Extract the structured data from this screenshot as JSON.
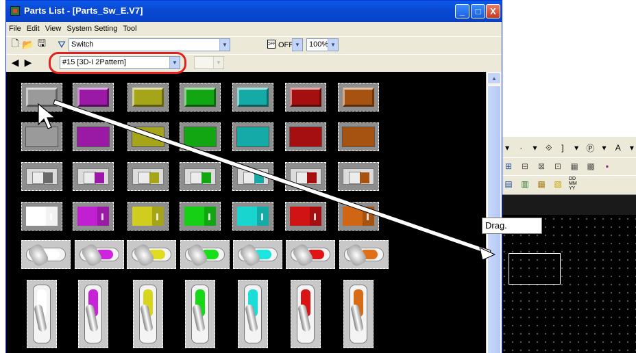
{
  "window": {
    "title": "Parts List - [Parts_Sw_E.V7]",
    "controls": {
      "minimize": "_",
      "maximize": "□",
      "close": "X"
    }
  },
  "menubar": [
    {
      "label": "File"
    },
    {
      "label": "Edit"
    },
    {
      "label": "View"
    },
    {
      "label": "System Setting"
    },
    {
      "label": "Tool"
    }
  ],
  "toolbar1": {
    "icons": [
      "new-file-icon",
      "open-folder-icon",
      "save-icon"
    ],
    "category_combo": "Switch",
    "state_badge": "OFF",
    "state_combo": "OFF",
    "zoom_combo": "100%"
  },
  "toolbar2": {
    "icons": [
      "back-arrow-icon",
      "forward-arrow-icon"
    ],
    "pattern_combo": "#15 [3D-I 2Pattern]",
    "disabled_combo": ""
  },
  "colors": {
    "gray": "#9a9a9a",
    "purple": "#9a1aa6",
    "olive": "#a6a418",
    "green": "#12a612",
    "cyan": "#14aaa6",
    "red": "#a60f0f",
    "orange": "#a65210",
    "highlight": "#e61e1e",
    "canvas": "#000000"
  },
  "parts_grid": {
    "row_styles": [
      "3d-button",
      "flat-button",
      "slide-switch",
      "rocker-switch",
      "lever-pill",
      "toggle-switch"
    ],
    "column_colors": [
      "gray",
      "purple",
      "olive",
      "green",
      "cyan",
      "red",
      "orange"
    ]
  },
  "annotation": {
    "drag_label": "Drag."
  },
  "editor": {
    "toolbar_glyphs_row1": [
      "▾",
      "·",
      "▾",
      "⟐",
      "]",
      "▾",
      "Ⓟ",
      "▾",
      "A",
      "▾"
    ],
    "toolbar_glyphs_row2": [
      "⊞",
      "⊟",
      "⊠",
      "⊡",
      "▦",
      "▩",
      "▪"
    ],
    "toolbar_glyphs_row3": [
      "▤",
      "▥",
      "▦",
      "▧",
      "▨"
    ],
    "mini_label": "DD MM YY"
  }
}
